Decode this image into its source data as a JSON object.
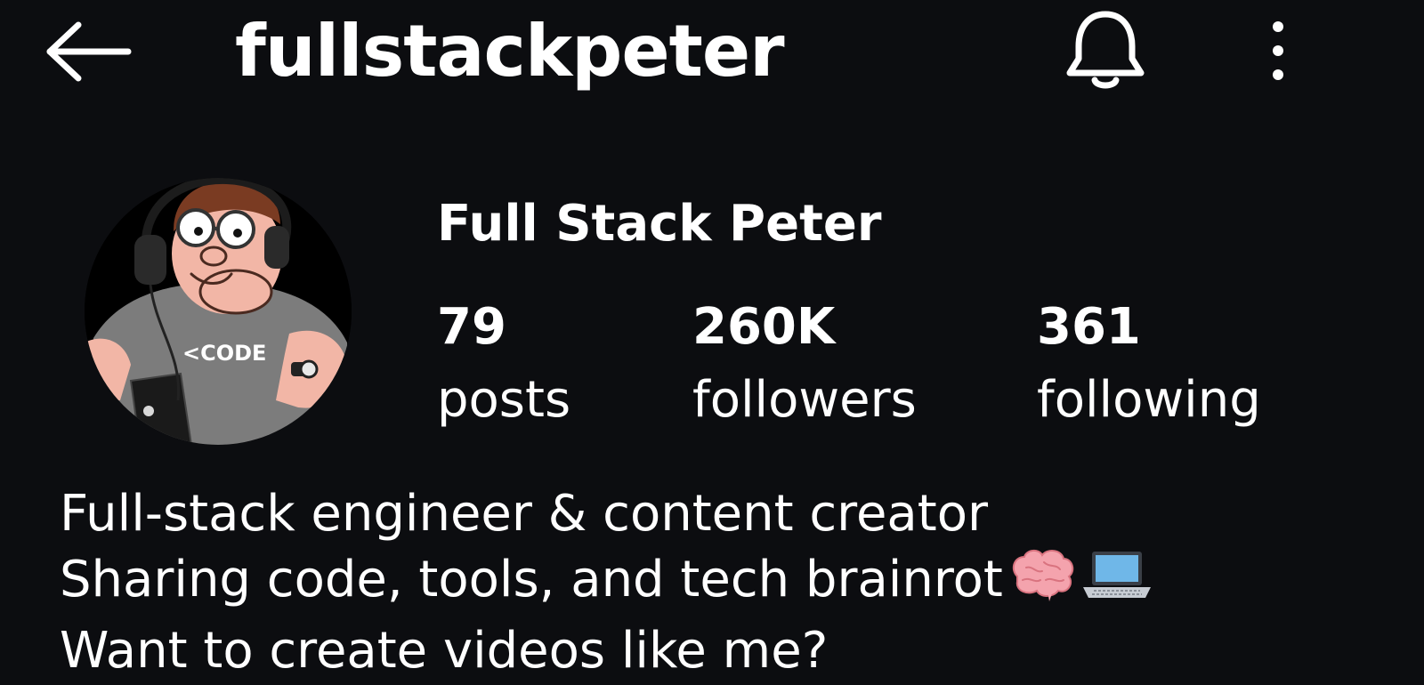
{
  "header": {
    "username": "fullstackpeter",
    "back_icon": "arrow-left-icon",
    "bell_icon": "bell-icon",
    "more_icon": "more-vertical-icon"
  },
  "profile": {
    "display_name": "Full Stack Peter",
    "avatar_text": "<CODE",
    "stats": [
      {
        "count": "79",
        "label": "posts"
      },
      {
        "count": "260K",
        "label": "followers"
      },
      {
        "count": "361",
        "label": "following"
      }
    ],
    "bio": [
      "Full-stack engineer & content creator",
      "Sharing code, tools, and tech brainrot",
      "Want to create videos like me?"
    ],
    "bio_emoji_icons": [
      "brain-emoji-icon",
      "laptop-emoji-icon"
    ]
  },
  "colors": {
    "background": "#0c0d10",
    "text": "#ffffff"
  }
}
